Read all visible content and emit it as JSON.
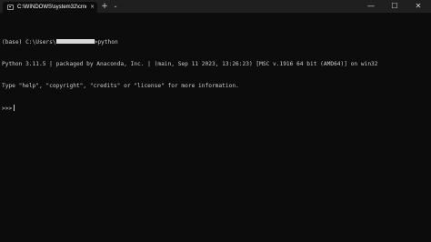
{
  "window": {
    "tab_title": "C:\\WINDOWS\\system32\\cmd.",
    "tab_close": "×",
    "new_tab": "+",
    "dropdown": "⌄",
    "minimize": "—",
    "maximize": "☐",
    "close": "✕"
  },
  "terminal": {
    "prompt_prefix": "(base) C:\\Users\\",
    "prompt_suffix": ">python",
    "version_line": "Python 3.11.5 | packaged by Anaconda, Inc. | (main, Sep 11 2023, 13:26:23) [MSC v.1916 64 bit (AMD64)] on win32",
    "help_line": "Type \"help\", \"copyright\", \"credits\" or \"license\" for more information.",
    "repl_prompt": ">>>"
  },
  "colors": {
    "background": "#0c0c0c",
    "titlebar": "#1f1f1f",
    "text": "#cccccc"
  },
  "icons": {
    "tab_icon": "terminal-icon"
  }
}
